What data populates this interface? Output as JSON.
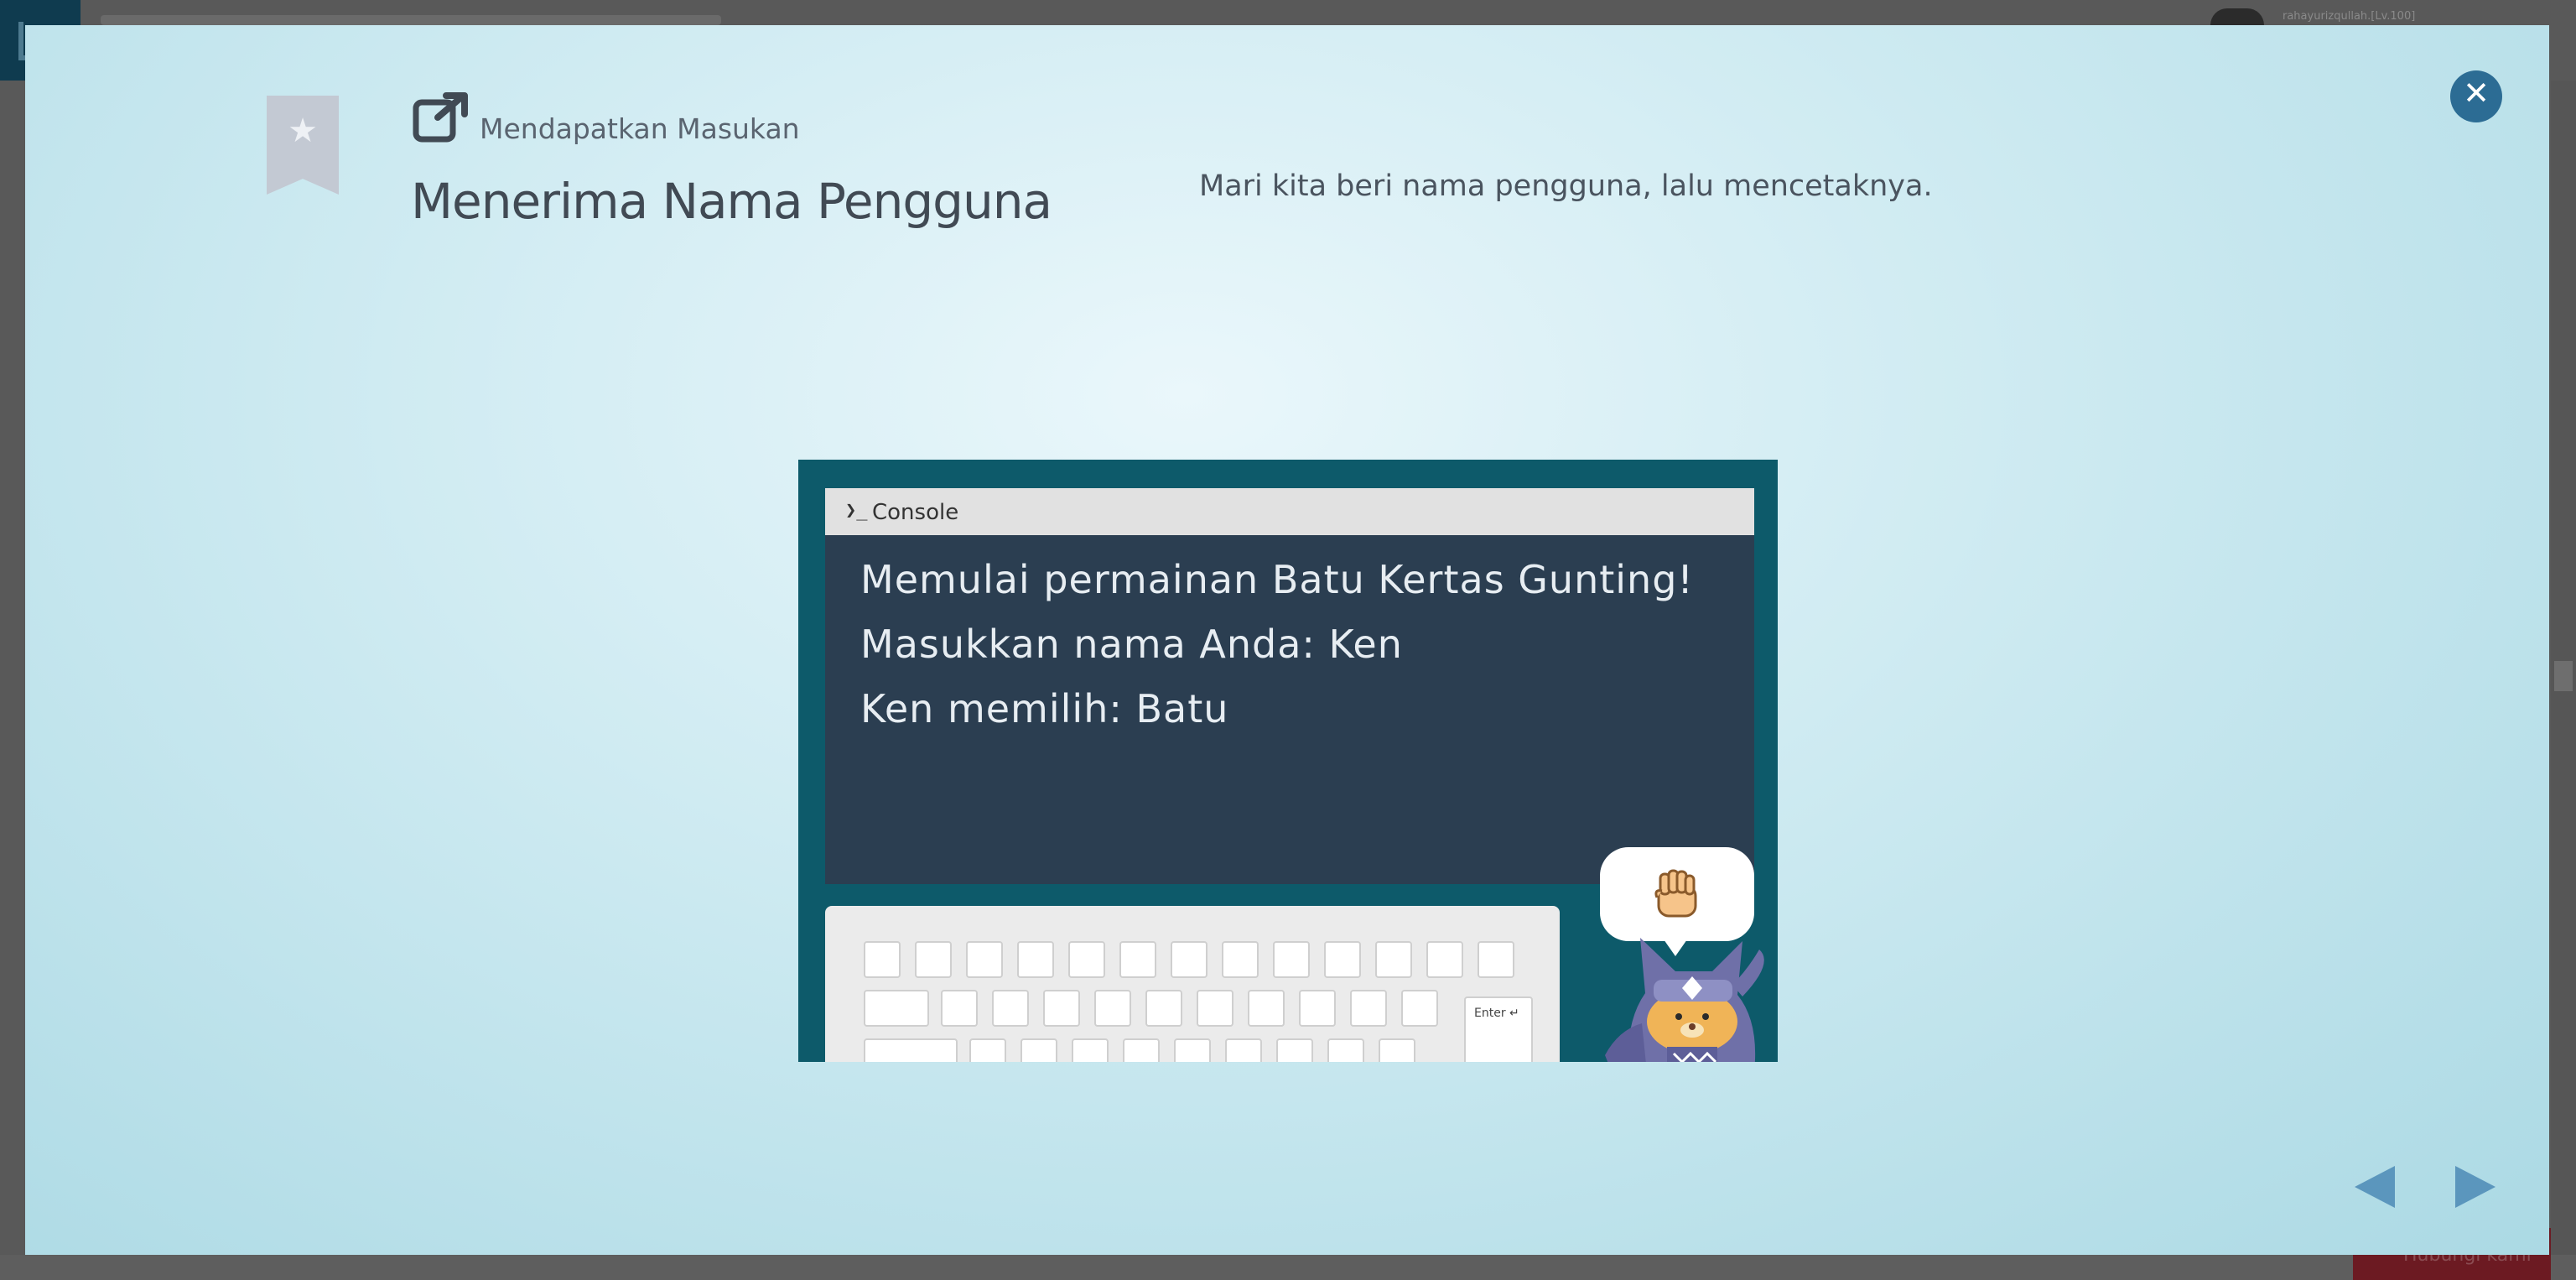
{
  "background_app": {
    "username": "rahayurizqullah.[Lv.100]",
    "action_button_label": "Hubungi kami"
  },
  "lesson": {
    "category": "Mendapatkan Masukan",
    "title": "Menerima Nama Pengguna",
    "description": "Mari kita beri nama pengguna, lalu mencetaknya."
  },
  "illustration": {
    "console_prompt": "❯_",
    "console_label": "Console",
    "lines": [
      "Memulai permainan Batu Kertas Gunting!",
      "Masukkan nama Anda: Ken",
      "Ken memilih: Batu"
    ],
    "enter_key_label": "Enter ↵",
    "bubble_icon": "rock-fist-icon",
    "character": "ninja-cat-character"
  },
  "icons": {
    "bookmark": "bookmark-star-icon",
    "category": "external-link-icon",
    "close": "close-icon",
    "prev": "arrow-left-icon",
    "next": "arrow-right-icon"
  },
  "colors": {
    "modal_background": "#cdeaf1",
    "close_button": "#2c6c94",
    "nav_arrow": "#5b96bd",
    "console_background": "#2b3e51",
    "illustration_frame": "#0d5a6a"
  }
}
